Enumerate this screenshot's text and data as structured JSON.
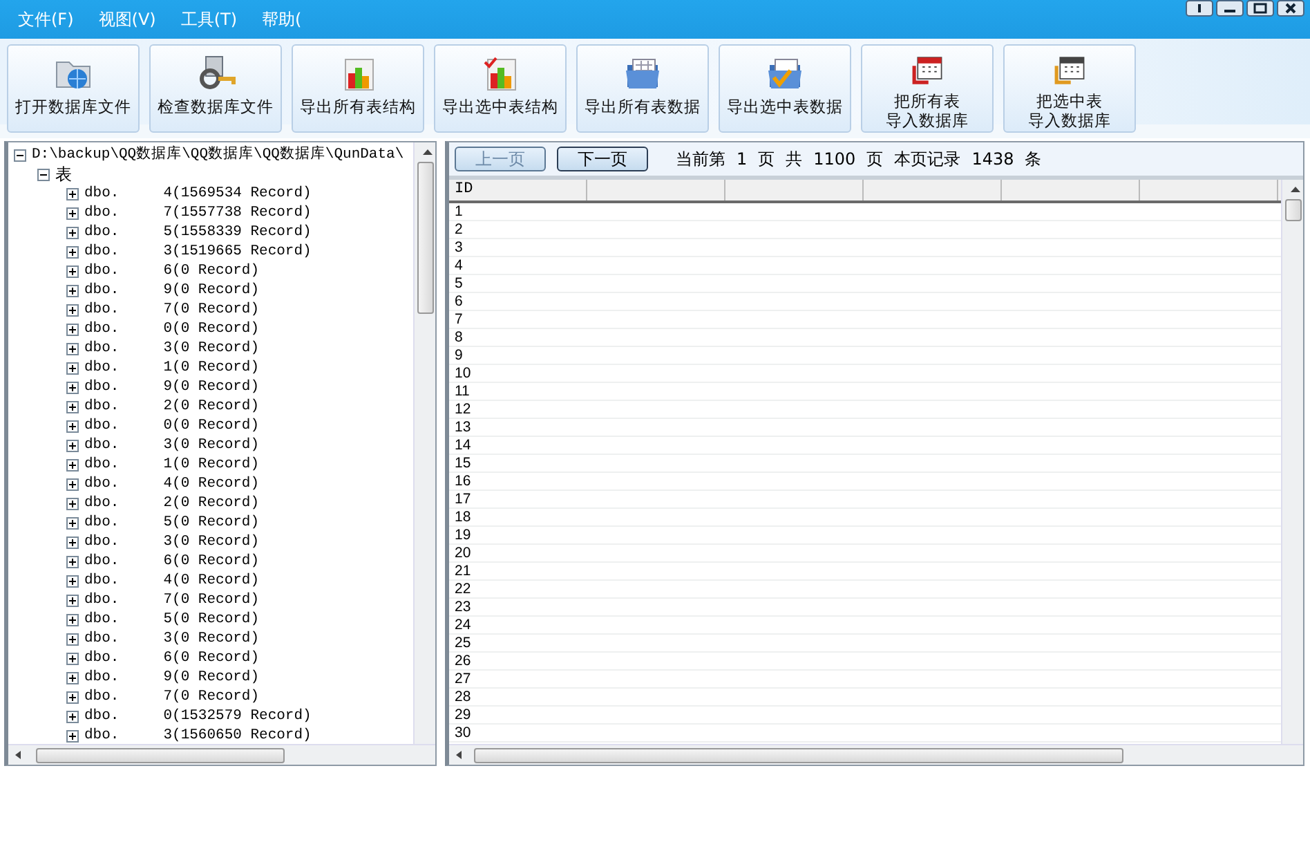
{
  "menu": [
    "文件(F)",
    "视图(V)",
    "工具(T)",
    "帮助("
  ],
  "toolbar": [
    {
      "label": "打开数据库文件"
    },
    {
      "label": "检查数据库文件"
    },
    {
      "label": "导出所有表结构"
    },
    {
      "label": "导出选中表结构"
    },
    {
      "label": "导出所有表数据"
    },
    {
      "label": "导出选中表数据"
    },
    {
      "label": "把所有表",
      "label_line_2": "导入数据库"
    },
    {
      "label": "把选中表",
      "label_line_2": "导入数据库"
    }
  ],
  "tree": [
    {
      "label": "D:\\backup\\QQ数据库\\QQ数据库\\QQ数据库\\QunData\\",
      "expanded": true,
      "children": [
        {
          "label": "表",
          "expanded": true,
          "children": [
            {
              "name": "dbo.",
              "count": "4(1569534 Record)",
              "expanded": false
            },
            {
              "name": "dbo.",
              "count": "7(1557738 Record)",
              "expanded": false
            },
            {
              "name": "dbo.",
              "count": "5(1558339 Record)",
              "expanded": false
            },
            {
              "name": "dbo.",
              "count": "3(1519665 Record)",
              "expanded": false
            },
            {
              "name": "dbo.",
              "count": "6(0 Record)",
              "expanded": false
            },
            {
              "name": "dbo.",
              "count": "9(0 Record)",
              "expanded": false
            },
            {
              "name": "dbo.",
              "count": "7(0 Record)",
              "expanded": false
            },
            {
              "name": "dbo.",
              "count": "0(0 Record)",
              "expanded": false
            },
            {
              "name": "dbo.",
              "count": "3(0 Record)",
              "expanded": false
            },
            {
              "name": "dbo.",
              "count": "1(0 Record)",
              "expanded": false
            },
            {
              "name": "dbo.",
              "count": "9(0 Record)",
              "expanded": false
            },
            {
              "name": "dbo.",
              "count": "2(0 Record)",
              "expanded": false
            },
            {
              "name": "dbo.",
              "count": "0(0 Record)",
              "expanded": false
            },
            {
              "name": "dbo.",
              "count": "3(0 Record)",
              "expanded": false
            },
            {
              "name": "dbo.",
              "count": "1(0 Record)",
              "expanded": false
            },
            {
              "name": "dbo.",
              "count": "4(0 Record)",
              "expanded": false
            },
            {
              "name": "dbo.",
              "count": "2(0 Record)",
              "expanded": false
            },
            {
              "name": "dbo.",
              "count": "5(0 Record)",
              "expanded": false
            },
            {
              "name": "dbo.",
              "count": "3(0 Record)",
              "expanded": false
            },
            {
              "name": "dbo.",
              "count": "6(0 Record)",
              "expanded": false
            },
            {
              "name": "dbo.",
              "count": "4(0 Record)",
              "expanded": false
            },
            {
              "name": "dbo.",
              "count": "7(0 Record)",
              "expanded": false
            },
            {
              "name": "dbo.",
              "count": "5(0 Record)",
              "expanded": false
            },
            {
              "name": "dbo.",
              "count": "3(0 Record)",
              "expanded": false
            },
            {
              "name": "dbo.",
              "count": "6(0 Record)",
              "expanded": false
            },
            {
              "name": "dbo.",
              "count": "9(0 Record)",
              "expanded": false
            },
            {
              "name": "dbo.",
              "count": "7(0 Record)",
              "expanded": false
            },
            {
              "name": "dbo.",
              "count": "0(1532579 Record)",
              "expanded": false
            },
            {
              "name": "dbo.",
              "count": "3(1560650 Record)",
              "expanded": false
            }
          ]
        }
      ]
    }
  ],
  "pager": {
    "buttons": [
      {
        "label": "上一页",
        "disabled": true
      },
      {
        "label": "下一页",
        "disabled": false
      }
    ],
    "texts": [
      "当前第",
      "1",
      "页",
      "共",
      "1100",
      "页",
      "本页记录",
      "1438",
      "条"
    ]
  },
  "table": {
    "columns": [
      "ID"
    ],
    "rows": [
      "1",
      "2",
      "3",
      "4",
      "5",
      "6",
      "7",
      "8",
      "9",
      "10",
      "11",
      "12",
      "13",
      "14",
      "15",
      "16",
      "17",
      "18",
      "19",
      "20",
      "21",
      "22",
      "23",
      "24",
      "25",
      "26",
      "27",
      "28",
      "29",
      "30"
    ]
  }
}
